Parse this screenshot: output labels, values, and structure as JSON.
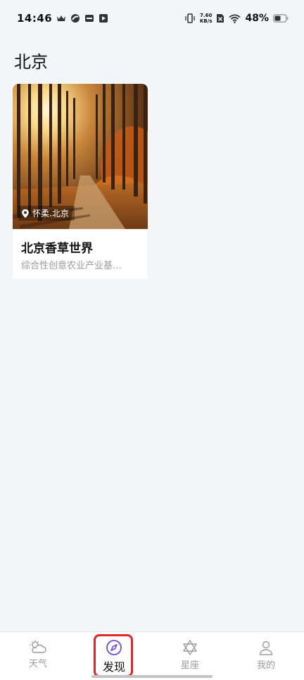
{
  "status_bar": {
    "time": "14:46",
    "net_speed_value": "7.60",
    "net_speed_unit": "KB/s",
    "battery": "48%"
  },
  "page": {
    "title": "北京"
  },
  "cards": [
    {
      "title": "北京香草世界",
      "location": "怀柔.北京",
      "description": "综合性创意农业产业基…"
    }
  ],
  "bottom_nav": {
    "items": [
      {
        "label": "天气",
        "icon": "weather-icon",
        "active": false
      },
      {
        "label": "发现",
        "icon": "compass-icon",
        "active": true
      },
      {
        "label": "星座",
        "icon": "star-of-david-icon",
        "active": false
      },
      {
        "label": "我的",
        "icon": "user-icon",
        "active": false
      }
    ],
    "active_color": "#6b4fd8",
    "inactive_color": "#9b9b9b"
  }
}
